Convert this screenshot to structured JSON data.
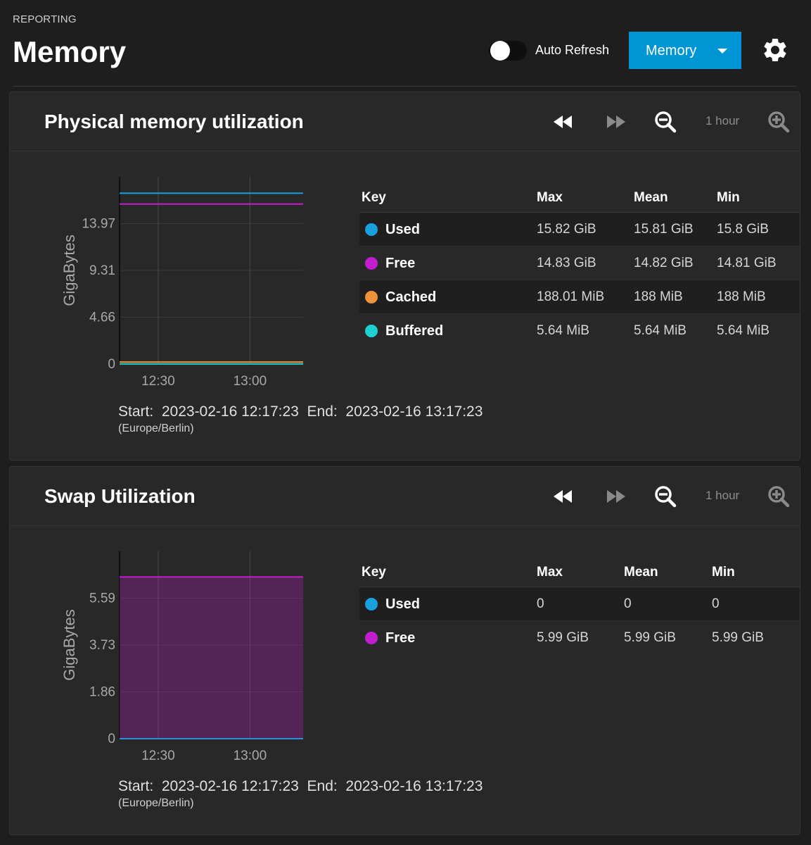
{
  "header": {
    "breadcrumb": "REPORTING",
    "title": "Memory",
    "auto_refresh_label": "Auto Refresh",
    "auto_refresh_on": false,
    "report_select": "Memory"
  },
  "colors": {
    "accent": "#0095d5",
    "used": "#1a9fe0",
    "free": "#c41ccf",
    "cached": "#f0923a",
    "buffered": "#1ed1d1"
  },
  "icons": {
    "back": "rewind-icon",
    "forward": "fast-forward-icon",
    "zoom_out": "zoom-out-icon",
    "zoom_in": "zoom-in-icon",
    "settings": "gear-icon"
  },
  "cards": [
    {
      "title": "Physical memory utilization",
      "range_label": "1 hour",
      "legend_header": {
        "key": "Key",
        "max": "Max",
        "mean": "Mean",
        "min": "Min"
      },
      "legend": [
        {
          "name": "Used",
          "max": "15.82 GiB",
          "mean": "15.81 GiB",
          "min": "15.8 GiB"
        },
        {
          "name": "Free",
          "max": "14.83 GiB",
          "mean": "14.82 GiB",
          "min": "14.81 GiB"
        },
        {
          "name": "Cached",
          "max": "188.01 MiB",
          "mean": "188 MiB",
          "min": "188 MiB"
        },
        {
          "name": "Buffered",
          "max": "5.64 MiB",
          "mean": "5.64 MiB",
          "min": "5.64 MiB"
        }
      ],
      "time_range": "Start:  2023-02-16 12:17:23  End:  2023-02-16 13:17:23",
      "timezone": "(Europe/Berlin)"
    },
    {
      "title": "Swap Utilization",
      "range_label": "1 hour",
      "legend_header": {
        "key": "Key",
        "max": "Max",
        "mean": "Mean",
        "min": "Min"
      },
      "legend": [
        {
          "name": "Used",
          "max": "0",
          "mean": "0",
          "min": "0"
        },
        {
          "name": "Free",
          "max": "5.99 GiB",
          "mean": "5.99 GiB",
          "min": "5.99 GiB"
        }
      ],
      "time_range": "Start:  2023-02-16 12:17:23  End:  2023-02-16 13:17:23",
      "timezone": "(Europe/Berlin)"
    }
  ],
  "chart_data": [
    {
      "type": "line",
      "ylabel": "GigaBytes",
      "ylim": [
        0,
        18.63
      ],
      "yticks": [
        "13.97",
        "9.31",
        "4.66",
        "0"
      ],
      "xticks": [
        "12:30",
        "13:00"
      ],
      "x": [
        "12:17:23",
        "13:17:23"
      ],
      "grid": true,
      "series": [
        {
          "name": "Used",
          "values": [
            16.99,
            16.99
          ]
        },
        {
          "name": "Free",
          "values": [
            15.92,
            15.92
          ]
        },
        {
          "name": "Cached",
          "values": [
            0.197,
            0.197
          ]
        },
        {
          "name": "Buffered",
          "values": [
            0.006,
            0.006
          ]
        }
      ]
    },
    {
      "type": "area",
      "ylabel": "GigaBytes",
      "ylim": [
        0,
        7.45
      ],
      "yticks": [
        "5.59",
        "3.73",
        "1.86",
        "0"
      ],
      "xticks": [
        "12:30",
        "13:00"
      ],
      "x": [
        "12:17:23",
        "13:17:23"
      ],
      "grid": true,
      "series": [
        {
          "name": "Used",
          "values": [
            0,
            0
          ]
        },
        {
          "name": "Free",
          "values": [
            6.43,
            6.43
          ]
        }
      ]
    }
  ]
}
